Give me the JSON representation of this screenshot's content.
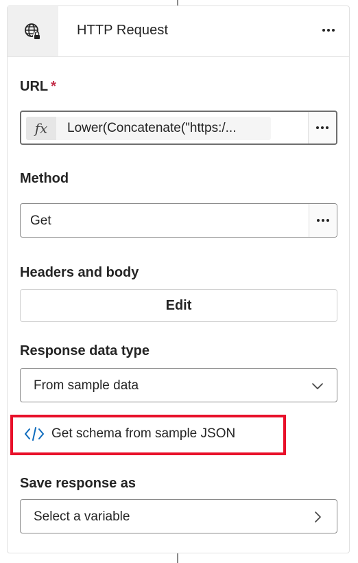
{
  "header": {
    "title": "HTTP Request",
    "icon": "globe-lock-icon",
    "more_icon": "more-horizontal-icon"
  },
  "url_field": {
    "label": "URL",
    "required_marker": "*",
    "fx_symbol": "fx",
    "value": "Lower(Concatenate(\"https:/..."
  },
  "method_field": {
    "label": "Method",
    "value": "Get"
  },
  "headers_body": {
    "label": "Headers and body",
    "button_label": "Edit"
  },
  "response_type": {
    "label": "Response data type",
    "selected": "From sample data"
  },
  "schema_link": {
    "label": "Get schema from sample JSON",
    "highlight_color": "#e8102a",
    "icon_color": "#0f6cbd"
  },
  "save_response": {
    "label": "Save response as",
    "placeholder": "Select a variable"
  }
}
